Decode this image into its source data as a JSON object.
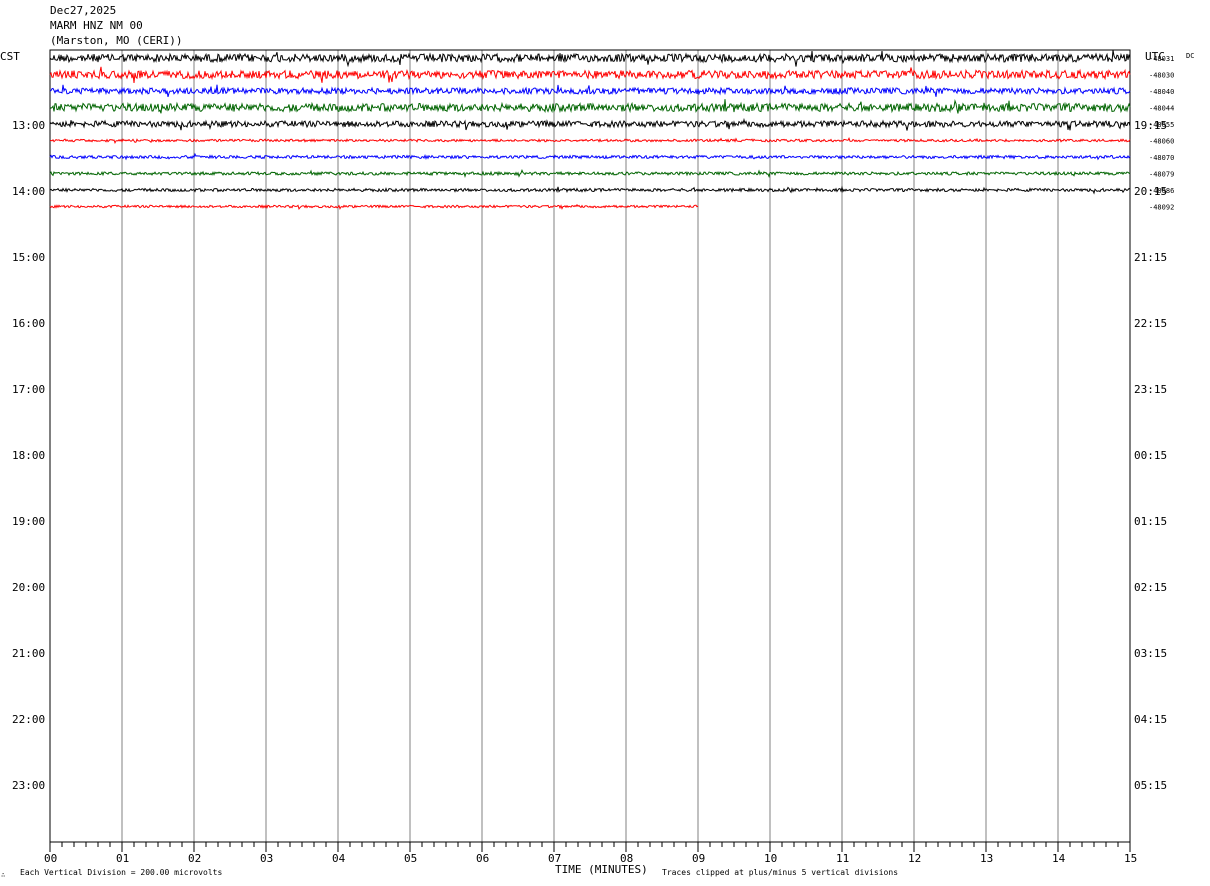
{
  "header": {
    "date": "Dec27,2025",
    "station": "MARM HNZ NM 00",
    "location": "(Marston, MO (CERI))"
  },
  "left_timezone": "CST",
  "right_timezone": "UTC",
  "dc_label": "DC",
  "footer": {
    "scale_note": "Each Vertical Division =  200.00 microvolts",
    "xlabel": "TIME (MINUTES)",
    "clip_note": "Traces clipped at plus/minus 5 vertical divisions"
  },
  "chart_data": {
    "type": "line",
    "title": "MARM HNZ NM 00",
    "xlabel": "TIME (MINUTES)",
    "x_range": [
      0,
      15
    ],
    "x_ticks": [
      "00",
      "01",
      "02",
      "03",
      "04",
      "05",
      "06",
      "07",
      "08",
      "09",
      "10",
      "11",
      "12",
      "13",
      "14",
      "15"
    ],
    "grid": "vertical lines each minute",
    "left_hour_labels": [
      "13:00",
      "14:00",
      "15:00",
      "16:00",
      "17:00",
      "18:00",
      "19:00",
      "20:00",
      "21:00",
      "22:00",
      "23:00"
    ],
    "right_hour_labels": [
      "19:15",
      "20:15",
      "21:15",
      "22:15",
      "23:15",
      "00:15",
      "01:15",
      "02:15",
      "03:15",
      "04:15",
      "05:15"
    ],
    "trace_colors": [
      "#000000",
      "#ff0000",
      "#0000ff",
      "#006400"
    ],
    "traces": [
      {
        "row": 0,
        "dc_offset": "-48031",
        "end_minute": 15,
        "amplitude": 4,
        "color": "#000000"
      },
      {
        "row": 1,
        "dc_offset": "-48030",
        "end_minute": 15,
        "amplitude": 4,
        "color": "#ff0000"
      },
      {
        "row": 2,
        "dc_offset": "-48040",
        "end_minute": 15,
        "amplitude": 3,
        "color": "#0000ff"
      },
      {
        "row": 3,
        "dc_offset": "-48044",
        "end_minute": 15,
        "amplitude": 4,
        "color": "#006400"
      },
      {
        "row": 4,
        "dc_offset": "-48055",
        "end_minute": 15,
        "amplitude": 3,
        "color": "#000000"
      },
      {
        "row": 5,
        "dc_offset": "-48060",
        "end_minute": 15,
        "amplitude": 1.2,
        "color": "#ff0000"
      },
      {
        "row": 6,
        "dc_offset": "-48070",
        "end_minute": 15,
        "amplitude": 1.5,
        "color": "#0000ff"
      },
      {
        "row": 7,
        "dc_offset": "-48079",
        "end_minute": 15,
        "amplitude": 1.5,
        "color": "#006400"
      },
      {
        "row": 8,
        "dc_offset": "-48086",
        "end_minute": 15,
        "amplitude": 1.5,
        "color": "#000000"
      },
      {
        "row": 9,
        "dc_offset": "-48092",
        "end_minute": 9,
        "amplitude": 1.2,
        "color": "#ff0000"
      }
    ]
  }
}
